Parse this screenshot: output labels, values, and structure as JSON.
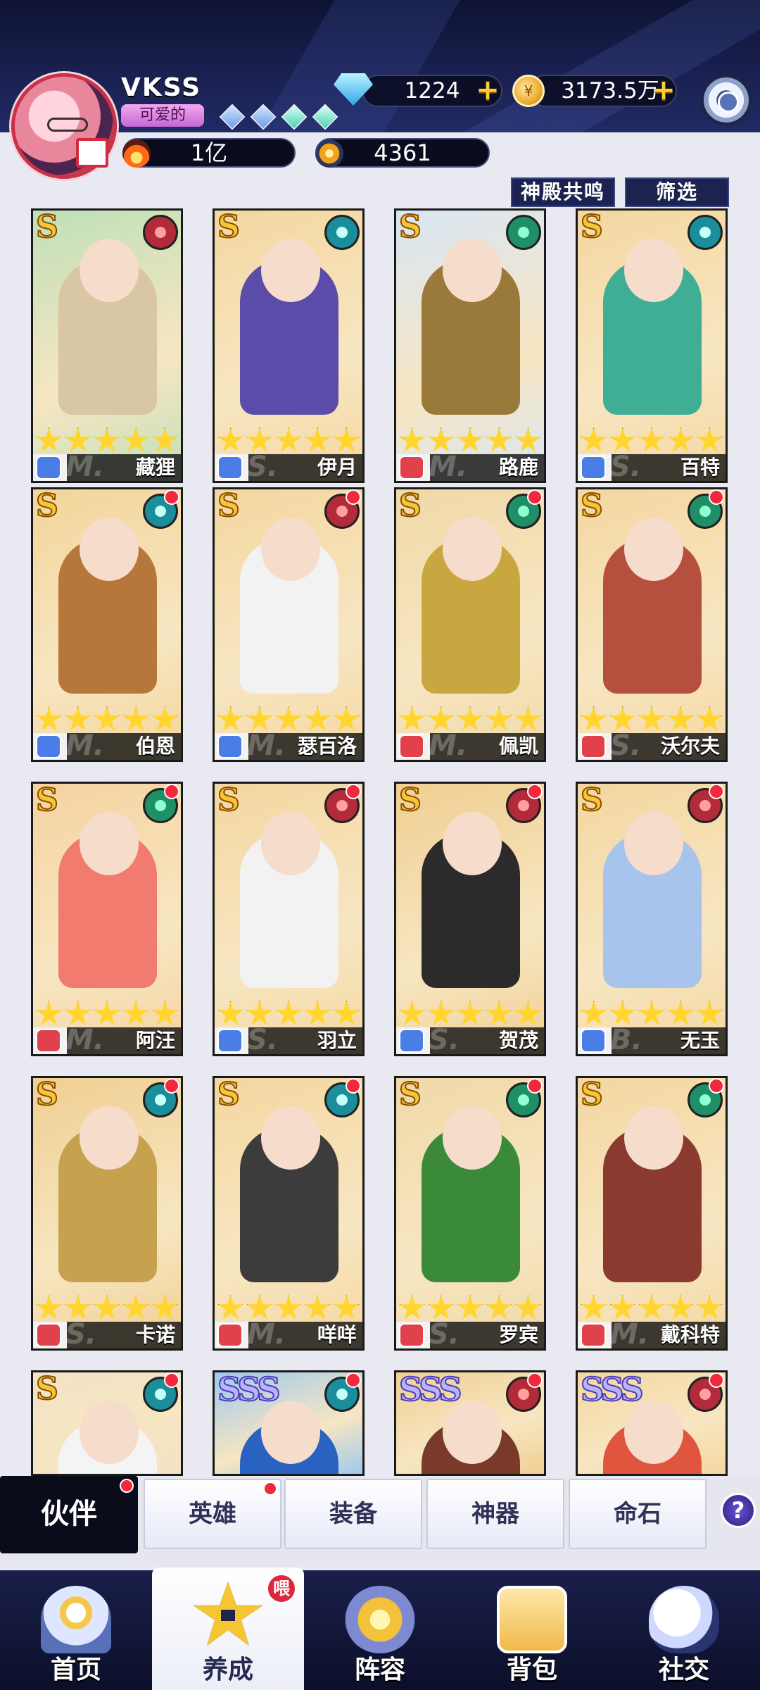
{
  "player": {
    "name": "VKSS",
    "title_badge": "可爱的",
    "diamonds": "1224",
    "gold": "3173.5万",
    "power": "1亿",
    "star_power": "4361"
  },
  "filters": {
    "resonance_label": "神殿共鸣",
    "filter_label": "筛选"
  },
  "heroes": [
    {
      "rank": "S",
      "name": "藏狸",
      "stars": 5,
      "faction": "red",
      "class": "blue",
      "grade": "M.",
      "bg": "#bfe0b8",
      "fg": "#d9c6a3"
    },
    {
      "rank": "S",
      "name": "伊月",
      "stars": 5,
      "faction": "teal",
      "class": "blue",
      "grade": "S.",
      "bg": "#f4d7a0",
      "fg": "#5a4ca8"
    },
    {
      "rank": "S",
      "name": "路鹿",
      "stars": 5,
      "faction": "green",
      "class": "red",
      "grade": "M.",
      "bg": "#d8e6f5",
      "fg": "#9a7a3a"
    },
    {
      "rank": "S",
      "name": "百特",
      "stars": 5,
      "faction": "teal",
      "class": "blue",
      "grade": "S.",
      "bg": "#f4d7a0",
      "fg": "#3fae95"
    },
    {
      "rank": "S",
      "name": "伯恩",
      "stars": 5,
      "faction": "teal",
      "class": "blue",
      "grade": "M.",
      "bg": "#f3d59a",
      "fg": "#b8773a"
    },
    {
      "rank": "S",
      "name": "瑟百洛",
      "stars": 5,
      "faction": "red",
      "class": "blue",
      "grade": "M.",
      "bg": "#f4d7a0",
      "fg": "#f2f2f2"
    },
    {
      "rank": "S",
      "name": "佩凯",
      "stars": 5,
      "faction": "green",
      "class": "red",
      "grade": "M.",
      "bg": "#f0d9a8",
      "fg": "#c9a740"
    },
    {
      "rank": "S",
      "name": "沃尔夫",
      "stars": 5,
      "faction": "green",
      "class": "red",
      "grade": "S.",
      "bg": "#f4d7a0",
      "fg": "#b5503e"
    },
    {
      "rank": "S",
      "name": "阿汪",
      "stars": 5,
      "faction": "green",
      "class": "red",
      "grade": "M.",
      "bg": "#f6d3a0",
      "fg": "#f07b6e"
    },
    {
      "rank": "S",
      "name": "羽立",
      "stars": 5,
      "faction": "red",
      "class": "blue",
      "grade": "S.",
      "bg": "#f4d7a0",
      "fg": "#f2f2f2"
    },
    {
      "rank": "S",
      "name": "贺茂",
      "stars": 5,
      "faction": "red",
      "class": "blue",
      "grade": "S.",
      "bg": "#f0cf92",
      "fg": "#2c2a2a"
    },
    {
      "rank": "S",
      "name": "无玉",
      "stars": 5,
      "faction": "red",
      "class": "blue",
      "grade": "B.",
      "bg": "#f4d7a0",
      "fg": "#a7c4ec"
    },
    {
      "rank": "S",
      "name": "卡诺",
      "stars": 5,
      "faction": "teal",
      "class": "red",
      "grade": "S.",
      "bg": "#f0cf92",
      "fg": "#c7a24e"
    },
    {
      "rank": "S",
      "name": "咩咩",
      "stars": 5,
      "faction": "teal",
      "class": "red",
      "grade": "M.",
      "bg": "#f4d7a0",
      "fg": "#3c3c3c"
    },
    {
      "rank": "S",
      "name": "罗宾",
      "stars": 5,
      "faction": "green",
      "class": "red",
      "grade": "S.",
      "bg": "#f0d9a8",
      "fg": "#3a8a3a"
    },
    {
      "rank": "S",
      "name": "戴科特",
      "stars": 5,
      "faction": "green",
      "class": "red",
      "grade": "M.",
      "bg": "#f4d7a0",
      "fg": "#8a3a2e"
    },
    {
      "rank": "S",
      "name": "",
      "stars": 0,
      "faction": "teal",
      "class": "red",
      "grade": "",
      "bg": "#f3e2c4",
      "fg": "#f4f4f4"
    },
    {
      "rank": "SSS",
      "name": "",
      "stars": 0,
      "faction": "teal",
      "class": "blue",
      "grade": "",
      "bg": "#9fc9ef",
      "fg": "#2a62c2"
    },
    {
      "rank": "SSS",
      "name": "",
      "stars": 0,
      "faction": "red",
      "class": "red",
      "grade": "",
      "bg": "#f0cf92",
      "fg": "#7a3a2a"
    },
    {
      "rank": "SSS",
      "name": "",
      "stars": 0,
      "faction": "red",
      "class": "red",
      "grade": "",
      "bg": "#f4d7a0",
      "fg": "#e0553e"
    }
  ],
  "tabs": [
    {
      "label": "伙伴",
      "active": true,
      "badge": true
    },
    {
      "label": "英雄",
      "active": false,
      "badge": true
    },
    {
      "label": "装备",
      "active": false,
      "badge": false
    },
    {
      "label": "神器",
      "active": false,
      "badge": false
    },
    {
      "label": "命石",
      "active": false,
      "badge": false
    }
  ],
  "help_label": "?",
  "nav": [
    {
      "label": "首页",
      "icon": "home-castle-icon"
    },
    {
      "label": "养成",
      "icon": "training-star-icon",
      "badge": "喂"
    },
    {
      "label": "阵容",
      "icon": "formation-shield-icon"
    },
    {
      "label": "背包",
      "icon": "bag-envelope-icon"
    },
    {
      "label": "社交",
      "icon": "social-ghost-icon"
    }
  ]
}
